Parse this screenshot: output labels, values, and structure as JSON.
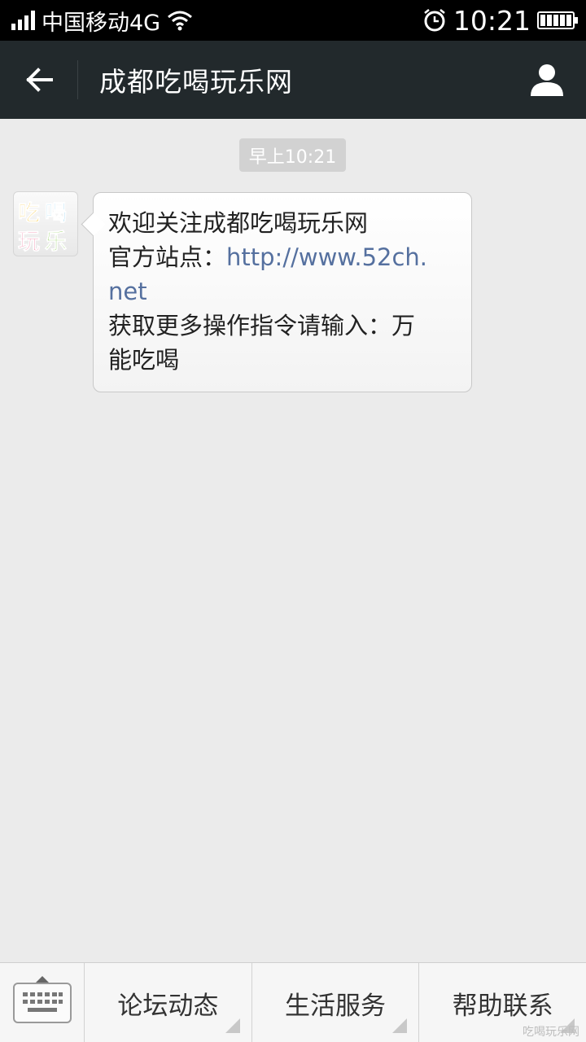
{
  "status_bar": {
    "carrier": "中国移动4G",
    "time": "10:21"
  },
  "header": {
    "title": "成都吃喝玩乐网",
    "back_icon": "arrow-left-icon",
    "profile_icon": "person-icon"
  },
  "chat": {
    "timestamp": "早上10:21",
    "message": {
      "line1": "欢迎关注成都吃喝玩乐网",
      "line2_label": "官方站点：",
      "line2_link_a": "http://www.52ch.",
      "line2_link_b": "net",
      "line3": "获取更多操作指令请输入：万",
      "line4": "能吃喝"
    },
    "avatar_logo": {
      "top": "吃喝",
      "bottom": "玩乐"
    }
  },
  "bottom_menu": {
    "items": [
      {
        "label": "论坛动态"
      },
      {
        "label": "生活服务"
      },
      {
        "label": "帮助联系"
      }
    ],
    "watermark": "吃喝玩乐网"
  }
}
